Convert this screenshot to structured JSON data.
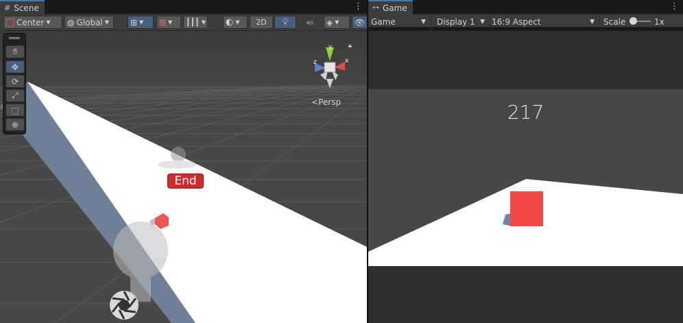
{
  "scene": {
    "tab_label": "Scene",
    "tab_icon": "grid-icon",
    "toolbar": {
      "pivot_label": "Center",
      "space_label": "Global",
      "mode_2d_label": "2D"
    },
    "tools": [
      "hand-tool",
      "move-tool",
      "rotate-tool",
      "scale-tool",
      "rect-tool",
      "transform-tool"
    ],
    "persp_label": "Persp",
    "gizmo_axes": {
      "x": "x",
      "y": "y",
      "z": "z"
    },
    "end_label": "End"
  },
  "game": {
    "tab_label": "Game",
    "tab_icon": "gamepad-icon",
    "toolbar": {
      "mode_label": "Game",
      "display_label": "Display 1",
      "aspect_label": "16:9 Aspect",
      "scale_label": "Scale",
      "scale_value": "1x"
    },
    "score": "217"
  },
  "colors": {
    "accent": "#3a79bb",
    "active_button": "#46607c",
    "end_badge": "#d02a2a",
    "cube": "#f24848"
  }
}
